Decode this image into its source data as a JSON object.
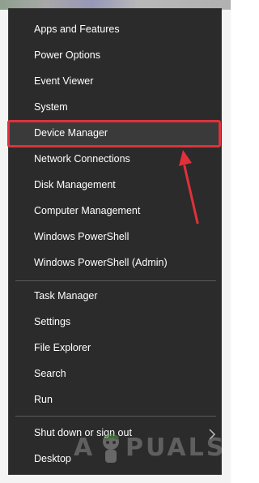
{
  "menu": {
    "group1": [
      "Apps and Features",
      "Power Options",
      "Event Viewer",
      "System",
      "Device Manager",
      "Network Connections",
      "Disk Management",
      "Computer Management",
      "Windows PowerShell",
      "Windows PowerShell (Admin)"
    ],
    "group2": [
      "Task Manager",
      "Settings",
      "File Explorer",
      "Search",
      "Run"
    ],
    "group3": [
      "Shut down or sign out",
      "Desktop"
    ]
  },
  "highlighted_item": "Device Manager",
  "watermark": {
    "prefix": "A",
    "rest": "PUALS"
  },
  "colors": {
    "menu_bg": "#2b2b2b",
    "text": "#ffffff",
    "highlight_border": "#e0313a",
    "arrow": "#e0313a"
  },
  "icons": {
    "submenu": "chevron-right-icon",
    "pointer": "red-arrow-icon"
  }
}
